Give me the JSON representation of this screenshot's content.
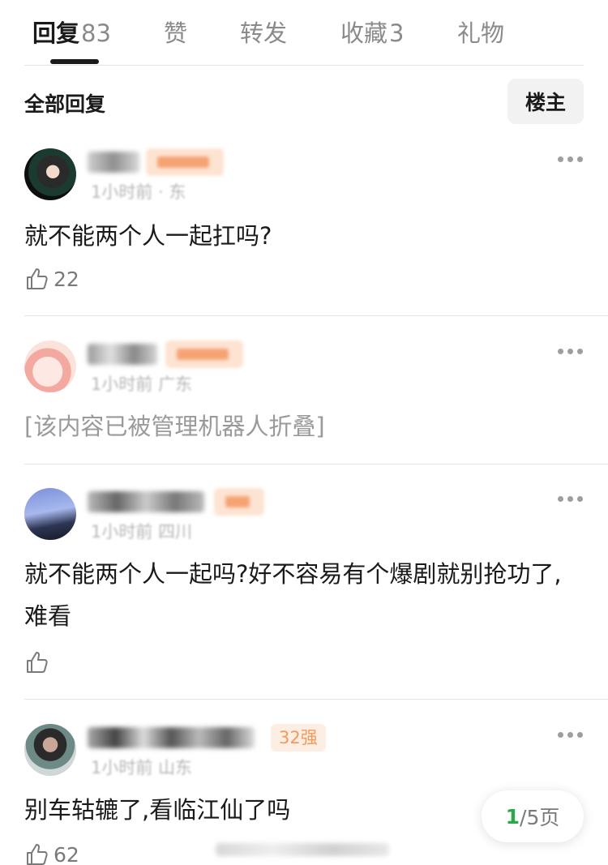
{
  "tabs": [
    {
      "label": "回复",
      "count": "83"
    },
    {
      "label": "赞",
      "count": ""
    },
    {
      "label": "转发",
      "count": ""
    },
    {
      "label": "收藏",
      "count": "3"
    },
    {
      "label": "礼物",
      "count": ""
    }
  ],
  "section": {
    "title": "全部回复",
    "filter_label": "楼主"
  },
  "comments": [
    {
      "meta": "1小时前 · 东",
      "text": "就不能两个人一起扛吗?",
      "likes": "22",
      "icon": "thumbs-up-icon"
    },
    {
      "meta": "1小时前 广东",
      "text": "[该内容已被管理机器人折叠]",
      "likes": "",
      "icon": "thumbs-up-icon"
    },
    {
      "meta": "1小时前 四川",
      "text": "就不能两个人一起吗?好不容易有个爆剧就别抢功了,难看",
      "likes": "",
      "icon": "thumbs-up-icon"
    },
    {
      "meta": "1小时前 山东",
      "rank": "32强",
      "text": "别车轱辘了,看临江仙了吗",
      "likes": "62",
      "icon": "thumbs-up-icon"
    }
  ],
  "pager": {
    "current": "1",
    "total": "/5页"
  },
  "colors": {
    "accent_green": "#2aa84a",
    "badge_orange": "#f29a5c"
  }
}
